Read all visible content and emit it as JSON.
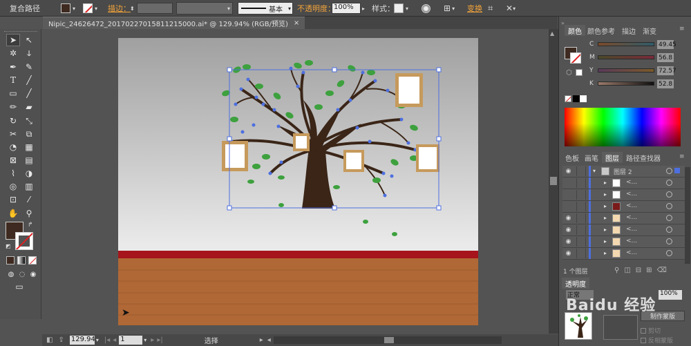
{
  "control_bar": {
    "object_type": "复合路径",
    "stroke_label": "描边：",
    "stroke_style": "基本",
    "opacity_label": "不透明度：",
    "opacity_value": "100%",
    "style_label": "样式：",
    "transform_link": "变换"
  },
  "document_tab": {
    "title": "Nipic_24626472_20170227015811215000.ai* @ 129.94% (RGB/预览)",
    "close": "×"
  },
  "status_bar": {
    "zoom": "129.94",
    "artboard_num": "1",
    "tool_status": "选择"
  },
  "color_panel": {
    "tabs": [
      "颜色",
      "颜色参考",
      "描边",
      "渐变"
    ],
    "channels": [
      {
        "label": "C",
        "value": "49.45"
      },
      {
        "label": "M",
        "value": "56.8"
      },
      {
        "label": "Y",
        "value": "72.57"
      },
      {
        "label": "K",
        "value": "52.8"
      }
    ]
  },
  "layers_panel": {
    "tabs": [
      "色板",
      "画笔",
      "图层",
      "路径查找器"
    ],
    "layer_name": "图层 2",
    "sublayer_label": "<...",
    "footer": "1 个图层"
  },
  "transparency_panel": {
    "title": "透明度",
    "blend_mode": "正常",
    "opacity": "100%",
    "make_mask": "制作蒙版",
    "clip": "剪切",
    "invert": "反相蒙版"
  },
  "watermark": "Baidu 经验",
  "colors": {
    "fill": "#3e2a20",
    "wall_stripe": "#a5151b",
    "floor": "#b06836",
    "leaf": "#3da13e",
    "bark": "#3a2517",
    "selection": "#4d6fe0",
    "frame": "#c69a5c"
  }
}
